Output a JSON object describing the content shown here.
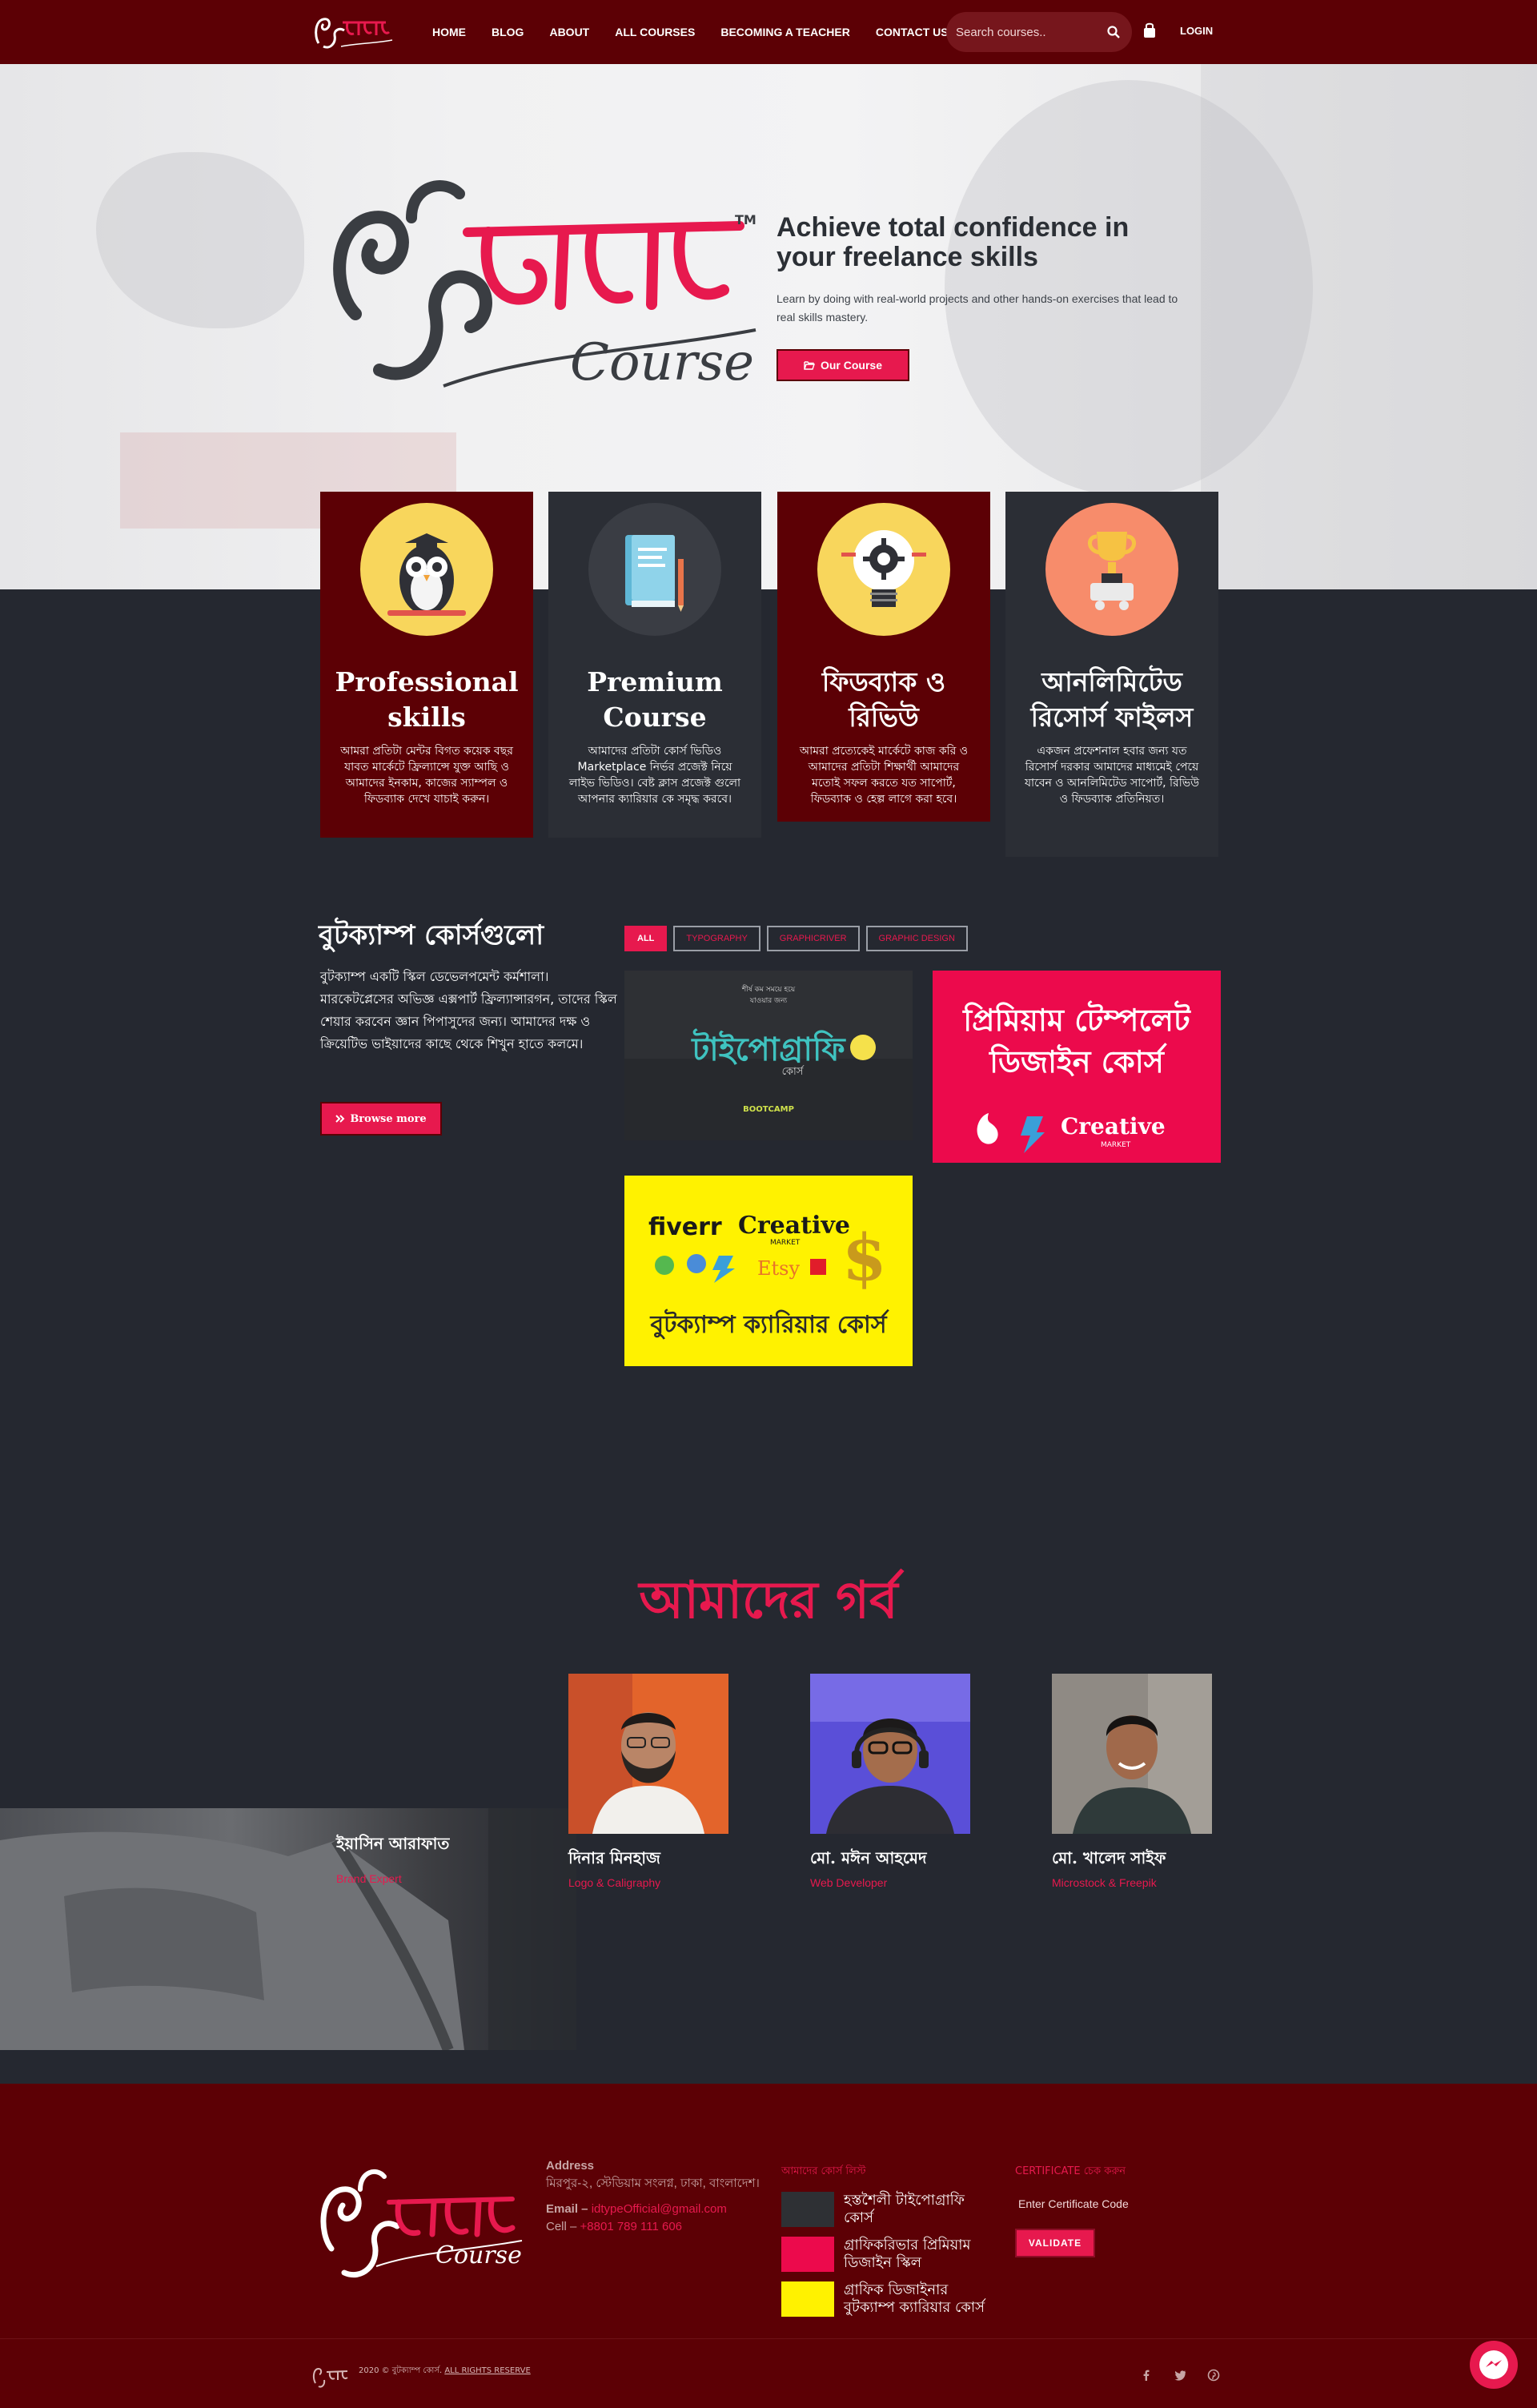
{
  "nav": {
    "logo_icon": "bootcamp-logo-icon",
    "items": [
      "HOME",
      "BLOG",
      "ABOUT",
      "ALL COURSES",
      "BECOMING A TEACHER",
      "CONTACT US"
    ],
    "search_placeholder": "Search courses..",
    "login": "LOGIN"
  },
  "hero": {
    "logo_word_course": "Course",
    "logo_tm": "TM",
    "headline": "Achieve total confidence in your freelance skills",
    "subtext": "Learn by doing with real-world projects and other hands-on exercises that lead to real skills mastery.",
    "button": "Our Course"
  },
  "features": [
    {
      "title": "Professional skills",
      "text": "আমরা প্রতিটা মেন্টর বিগত কয়েক বছর যাবত মার্কেটে ফ্রিল্যান্সে যুক্ত আছি ও আমাদের ইনকাম, কাজের স্যাম্পল ও ফিডব্যাক দেখে যাচাই করুন।",
      "icon": "owl-icon"
    },
    {
      "title": "Premium Course",
      "text": "আমাদের প্রতিটা কোর্স ভিডিও Marketplace নির্ভর প্রজেক্ট নিয়ে লাইভ ভিডিও। বেষ্ট ক্লাস প্রজেক্ট গুলো আপনার ক্যারিয়ার কে সমৃদ্ধ করবে।",
      "icon": "book-icon"
    },
    {
      "title": "ফিডব্যাক ও রিভিউ",
      "text": "আমরা প্রত্যেকেই মার্কেটে কাজ করি ও আমাদের প্রতিটা শিক্ষার্থী আমাদের মতোই সফল করতে যত সাপোর্ট, ফিডব্যাক ও হেল্প লাগে করা হবে।",
      "icon": "idea-gear-icon"
    },
    {
      "title": "আনলিমিটেড রিসোর্স ফাইলস",
      "text": "একজন প্রফেশনাল হবার জন্য যত রিসোর্স দরকার আমাদের মাধ্যমেই পেয়ে যাবেন ও আনলিমিটেড সাপোর্ট, রিভিউ ও ফিডব্যাক প্রতিনিয়ত।",
      "icon": "trophy-icon"
    }
  ],
  "courses": {
    "title": "বুটক্যাম্প কোর্সগুলো",
    "description": "বুটক্যাম্প একটি স্কিল ডেভেলপমেন্ট কর্মশালা। মারকেটপ্লেসের অভিজ্ঞ এক্সপার্ট ফ্রিল্যান্সারগন, তাদের স্কিল শেয়ার করবেন জ্ঞান পিপাসুদের জন্য। আমাদের দক্ষ ও ক্রিয়েটিভ ভাইয়াদের কাছে থেকে শিখুন হাতে কলমে।",
    "browse": "Browse more",
    "filters": [
      "ALL",
      "TYPOGRAPHY",
      "GRAPHICRIVER",
      "GRAPHIC DESIGN"
    ],
    "tile1": {
      "top_line1": "শীর্ষ কম সময়ে হয়ে",
      "top_line2": "যাওয়ার জন্য",
      "title": "টাইপোগ্রাফি",
      "sub": "কোর্স",
      "badge": "BOOTCAMP"
    },
    "tile2": {
      "title": "প্রিমিয়াম টেম্পলেট ডিজাইন কোর্স",
      "brand": "Creative",
      "brand_sub": "MARKET"
    },
    "tile3": {
      "fiverr": "fiverr",
      "creative": "Creative",
      "market": "MARKET",
      "etsy": "Etsy",
      "title": "বুটক্যাম্প ক্যারিয়ার কোর্স"
    }
  },
  "pride": {
    "title": "আমাদের গর্ব",
    "featured": {
      "name": "ইয়াসিন আরাফাত",
      "role": "Brand Expert"
    },
    "members": [
      {
        "name": "দিনার মিনহাজ",
        "role": "Logo & Caligraphy"
      },
      {
        "name": "মো. মঈন আহমেদ",
        "role": "Web Developer"
      },
      {
        "name": "মো. খালেদ সাইফ",
        "role": "Microstock & Freepik"
      }
    ]
  },
  "footer": {
    "address_label": "Address",
    "address_text": "মিরপুর-২, স্টেডিয়াম সংলগ্ন, ঢাকা, বাংলাদেশ।",
    "email_label": "Email –",
    "email": "idtypeOfficial@gmail.com",
    "cell_label": "Cell –",
    "cell": "+8801 789 111 606",
    "courses_title": "আমাদের কোর্স লিস্ট",
    "courses": [
      "হস্তশৈলী টাইপোগ্রাফি কোর্স",
      "গ্রাফিকরিভার প্রিমিয়াম ডিজাইন স্কিল",
      "গ্রাফিক ডিজাইনার বুটক্যাম্প ক্যারিয়ার কোর্স"
    ],
    "cert_title": "CERTIFICATE চেক করুন",
    "cert_placeholder": "Enter Certificate Code",
    "validate": "VALIDATE",
    "copyright_pre": "2020 © বুটক্যাম্প কোর্স.",
    "copyright_link": "ALL RIGHTS RESERVE",
    "social": [
      "facebook-icon",
      "twitter-icon",
      "pinterest-icon"
    ]
  },
  "colors": {
    "accent": "#e7194e",
    "brand_dark": "#5c0005",
    "body_dark": "#252830"
  }
}
